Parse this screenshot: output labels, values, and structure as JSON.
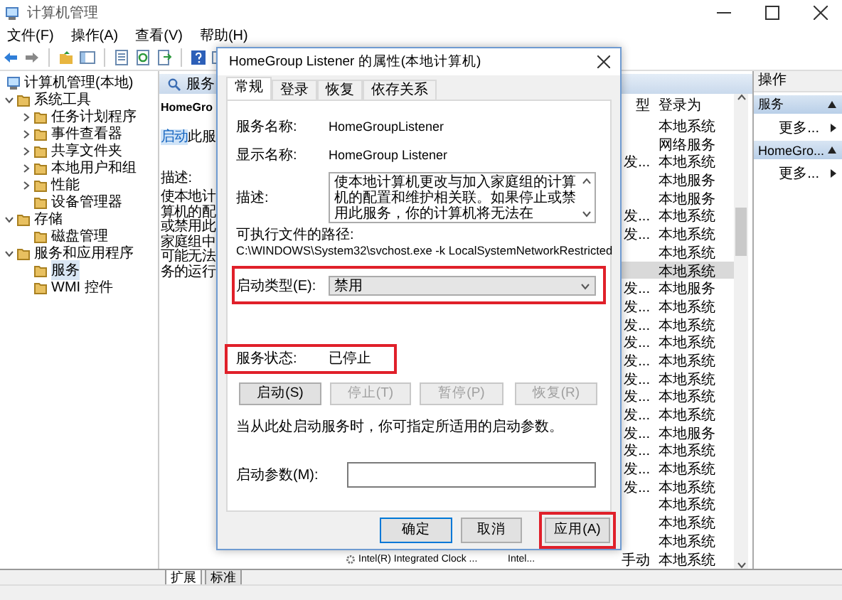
{
  "window": {
    "title": "计算机管理"
  },
  "menu": [
    "文件(F)",
    "操作(A)",
    "查看(V)",
    "帮助(H)"
  ],
  "tree": [
    {
      "label": "计算机管理(本地)",
      "selected": false,
      "children": [
        {
          "label": "系统工具",
          "expanded": true,
          "selected": false,
          "children": [
            {
              "label": "任务计划程序",
              "expanded": false,
              "selected": false
            },
            {
              "label": "事件查看器",
              "expanded": false,
              "selected": false
            },
            {
              "label": "共享文件夹",
              "expanded": false,
              "selected": false
            },
            {
              "label": "本地用户和组",
              "expanded": false,
              "selected": false
            },
            {
              "label": "性能",
              "expanded": false,
              "selected": false
            },
            {
              "label": "设备管理器",
              "selected": false
            }
          ]
        },
        {
          "label": "存储",
          "expanded": true,
          "selected": false,
          "children": [
            {
              "label": "磁盘管理",
              "selected": false
            }
          ]
        },
        {
          "label": "服务和应用程序",
          "expanded": true,
          "selected": false,
          "children": [
            {
              "label": "服务",
              "selected": true
            },
            {
              "label": "WMI 控件",
              "selected": false
            }
          ]
        }
      ]
    }
  ],
  "services": {
    "tab": "服务",
    "detail": {
      "title": "HomeGro",
      "link": "启动",
      "link_suffix": "此服",
      "description_label": "描述:",
      "description_lines": [
        "使本地计",
        "算机的配",
        "或禁用此",
        "家庭组中",
        "可能无法",
        "务的运行"
      ]
    },
    "columns": [
      "型",
      "登录为"
    ],
    "rows": [
      {
        "login_as": "本地系统",
        "selected": false
      },
      {
        "login_as": "网络服务",
        "selected": false
      },
      {
        "startup_type": "发...",
        "login_as": "本地系统",
        "selected": false
      },
      {
        "login_as": "本地服务",
        "selected": false
      },
      {
        "login_as": "本地服务",
        "selected": false
      },
      {
        "startup_type": "发...",
        "login_as": "本地系统",
        "selected": false
      },
      {
        "startup_type": "发...",
        "login_as": "本地系统",
        "selected": false
      },
      {
        "login_as": "本地系统",
        "selected": false
      },
      {
        "login_as": "本地系统",
        "selected": true
      },
      {
        "startup_type": "发...",
        "login_as": "本地服务",
        "selected": false
      },
      {
        "startup_type": "发...",
        "login_as": "本地系统",
        "selected": false
      },
      {
        "startup_type": "发...",
        "login_as": "本地系统",
        "selected": false
      },
      {
        "startup_type": "发...",
        "login_as": "本地系统",
        "selected": false
      },
      {
        "startup_type": "发...",
        "login_as": "本地系统",
        "selected": false
      },
      {
        "startup_type": "发...",
        "login_as": "本地系统",
        "selected": false
      },
      {
        "startup_type": "发...",
        "login_as": "本地系统",
        "selected": false
      },
      {
        "startup_type": "发...",
        "login_as": "本地系统",
        "selected": false
      },
      {
        "startup_type": "发...",
        "login_as": "本地服务",
        "selected": false
      },
      {
        "startup_type": "发...",
        "login_as": "本地系统",
        "selected": false
      },
      {
        "startup_type": "发...",
        "login_as": "本地系统",
        "selected": false
      },
      {
        "startup_type": "发...",
        "login_as": "本地系统",
        "selected": false
      },
      {
        "login_as": "本地系统",
        "selected": false
      },
      {
        "login_as": "本地系统",
        "selected": false
      },
      {
        "login_as": "本地系统",
        "selected": false
      },
      {
        "name": "Intel(R) Integrated Clock ...",
        "description": "Intel...",
        "startup_type": "手动",
        "login_as": "本地系统",
        "selected": false
      }
    ]
  },
  "actions": {
    "title": "操作",
    "groups": [
      {
        "label": "服务",
        "items": [
          "更多..."
        ]
      },
      {
        "label": "HomeGro...",
        "items": [
          "更多..."
        ]
      }
    ]
  },
  "bottom_tabs": [
    {
      "label": "扩展",
      "selected": true
    },
    {
      "label": "标准",
      "selected": false
    }
  ],
  "dialog": {
    "title": "HomeGroup Listener 的属性(本地计算机)",
    "tabs": [
      {
        "label": "常规",
        "selected": true
      },
      {
        "label": "登录",
        "selected": false
      },
      {
        "label": "恢复",
        "selected": false
      },
      {
        "label": "依存关系",
        "selected": false
      }
    ],
    "service_name": {
      "label": "服务名称:",
      "value": "HomeGroupListener"
    },
    "display_name": {
      "label": "显示名称:",
      "value": "HomeGroup Listener"
    },
    "description": {
      "label": "描述:",
      "value": "使本地计算机更改与加入家庭组的计算机的配置和维护相关联。如果停止或禁用此服务，你的计算机将无法在"
    },
    "path_label": "可执行文件的路径:",
    "path": "C:\\WINDOWS\\System32\\svchost.exe -k LocalSystemNetworkRestricted",
    "startup_type": {
      "label": "启动类型(E):",
      "value": "禁用",
      "highlighted": true
    },
    "status": {
      "label": "服务状态:",
      "value": "已停止",
      "highlighted": true
    },
    "control_buttons": [
      {
        "label": "启动(S)",
        "disabled": false
      },
      {
        "label": "停止(T)",
        "disabled": true
      },
      {
        "label": "暂停(P)",
        "disabled": true
      },
      {
        "label": "恢复(R)",
        "disabled": true
      }
    ],
    "hint": "当从此处启动服务时，你可指定所适用的启动参数。",
    "start_params": {
      "label": "启动参数(M):"
    },
    "buttons": [
      {
        "label": "确定",
        "default": true,
        "highlighted": false
      },
      {
        "label": "取消",
        "default": false,
        "highlighted": false
      },
      {
        "label": "应用(A)",
        "default": false,
        "highlighted": true
      }
    ]
  }
}
